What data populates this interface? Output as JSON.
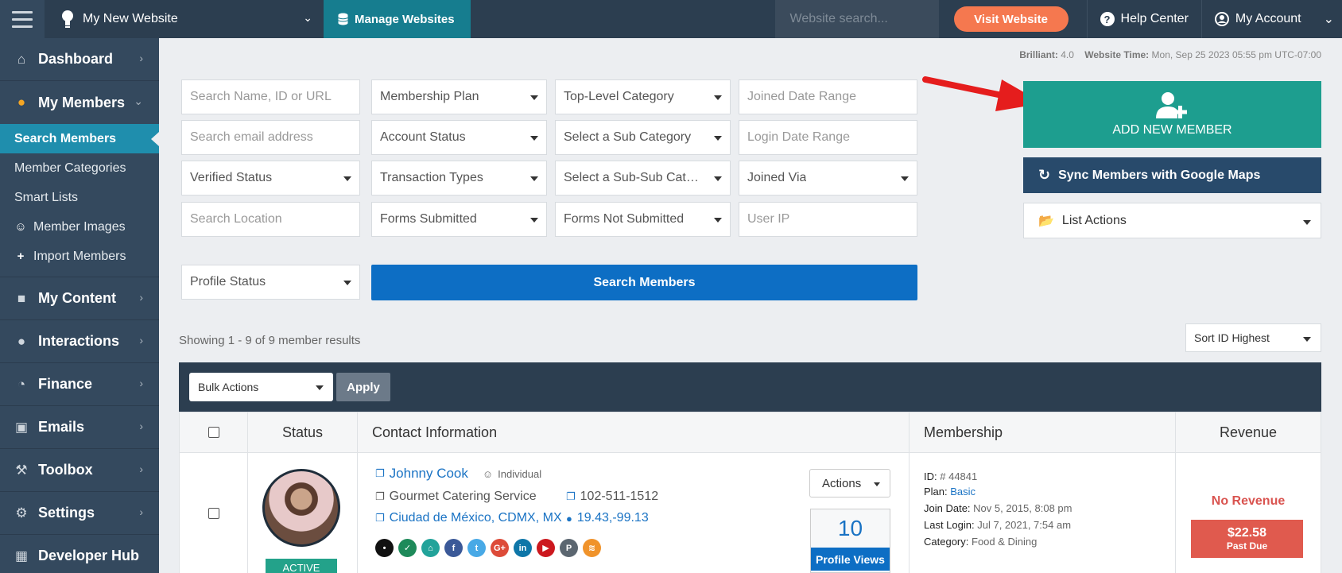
{
  "topbar": {
    "site_name": "My New Website",
    "manage_label": "Manage Websites",
    "search_placeholder": "Website search...",
    "visit_label": "Visit Website",
    "help_label": "Help Center",
    "account_label": "My Account"
  },
  "sidebar": {
    "items": [
      {
        "label": "Dashboard",
        "icon": "home-icon"
      },
      {
        "label": "My Members",
        "icon": "users-icon"
      },
      {
        "label": "My Content",
        "icon": "folder-icon"
      },
      {
        "label": "Interactions",
        "icon": "comments-icon"
      },
      {
        "label": "Finance",
        "icon": "pie-chart-icon"
      },
      {
        "label": "Emails",
        "icon": "inbox-icon"
      },
      {
        "label": "Toolbox",
        "icon": "wrench-icon"
      },
      {
        "label": "Settings",
        "icon": "gear-icon"
      },
      {
        "label": "Developer Hub",
        "icon": "grid-icon"
      }
    ],
    "sub_items": [
      {
        "label": "Search Members",
        "active": true
      },
      {
        "label": "Member Categories"
      },
      {
        "label": "Smart Lists"
      },
      {
        "label": "Member Images",
        "icon": "user-circle-icon"
      },
      {
        "label": "Import Members",
        "icon": "plus-icon"
      }
    ]
  },
  "meta": {
    "brilliant_label": "Brilliant:",
    "brilliant_value": "4.0",
    "time_label": "Website Time:",
    "time_value": "Mon, Sep 25 2023 05:55 pm UTC-07:00"
  },
  "filters": {
    "name": "Search Name, ID or URL",
    "plan": "Membership Plan",
    "top_category": "Top-Level Category",
    "joined_range": "Joined Date Range",
    "email": "Search email address",
    "account_status": "Account Status",
    "sub_category": "Select a Sub Category",
    "login_range": "Login Date Range",
    "verified": "Verified Status",
    "transactions": "Transaction Types",
    "subsub_category": "Select a Sub-Sub Category",
    "joined_via": "Joined Via",
    "location": "Search Location",
    "forms_submitted": "Forms Submitted",
    "forms_not_submitted": "Forms Not Submitted",
    "user_ip": "User IP",
    "profile_status": "Profile Status",
    "search_button": "Search Members"
  },
  "actions": {
    "add_member": "ADD NEW MEMBER",
    "sync": "Sync Members with Google Maps",
    "list_actions": "List Actions"
  },
  "results": {
    "showing": "Showing 1 - 9 of 9 member results",
    "sort": "Sort ID Highest",
    "bulk": "Bulk Actions",
    "apply": "Apply"
  },
  "table": {
    "headers": {
      "status": "Status",
      "contact": "Contact Information",
      "membership": "Membership",
      "revenue": "Revenue"
    },
    "row": {
      "name": "Johnny Cook",
      "type": "Individual",
      "company": "Gourmet Catering Service",
      "phone": "102-511-1512",
      "location": "Ciudad de México, CDMX, MX",
      "coords": "19.43,-99.13",
      "status": "ACTIVE",
      "actions": "Actions",
      "views": "10",
      "views_label": "Profile Views",
      "id_label": "ID:",
      "id_value": "# 44841",
      "plan_label": "Plan:",
      "plan_value": "Basic",
      "join_label": "Join Date:",
      "join_value": "Nov 5, 2015, 8:08 pm",
      "login_label": "Last Login:",
      "login_value": "Jul 7, 2021, 7:54 am",
      "category_label": "Category:",
      "category_value": "Food & Dining",
      "revenue": "No Revenue",
      "due_amount": "$22.58",
      "due_label": "Past Due",
      "socials": [
        {
          "name": "pin-icon",
          "color": "#111111"
        },
        {
          "name": "check-icon",
          "color": "#1e8a5a"
        },
        {
          "name": "home-icon",
          "color": "#22a39a"
        },
        {
          "name": "facebook-icon",
          "color": "#3b5998"
        },
        {
          "name": "twitter-icon",
          "color": "#48a9e6"
        },
        {
          "name": "google-plus-icon",
          "color": "#dd4b39"
        },
        {
          "name": "linkedin-icon",
          "color": "#0e76a8"
        },
        {
          "name": "youtube-icon",
          "color": "#cc181e"
        },
        {
          "name": "pinterest-icon",
          "color": "#5b6670"
        },
        {
          "name": "rss-icon",
          "color": "#f0932b"
        }
      ]
    }
  }
}
